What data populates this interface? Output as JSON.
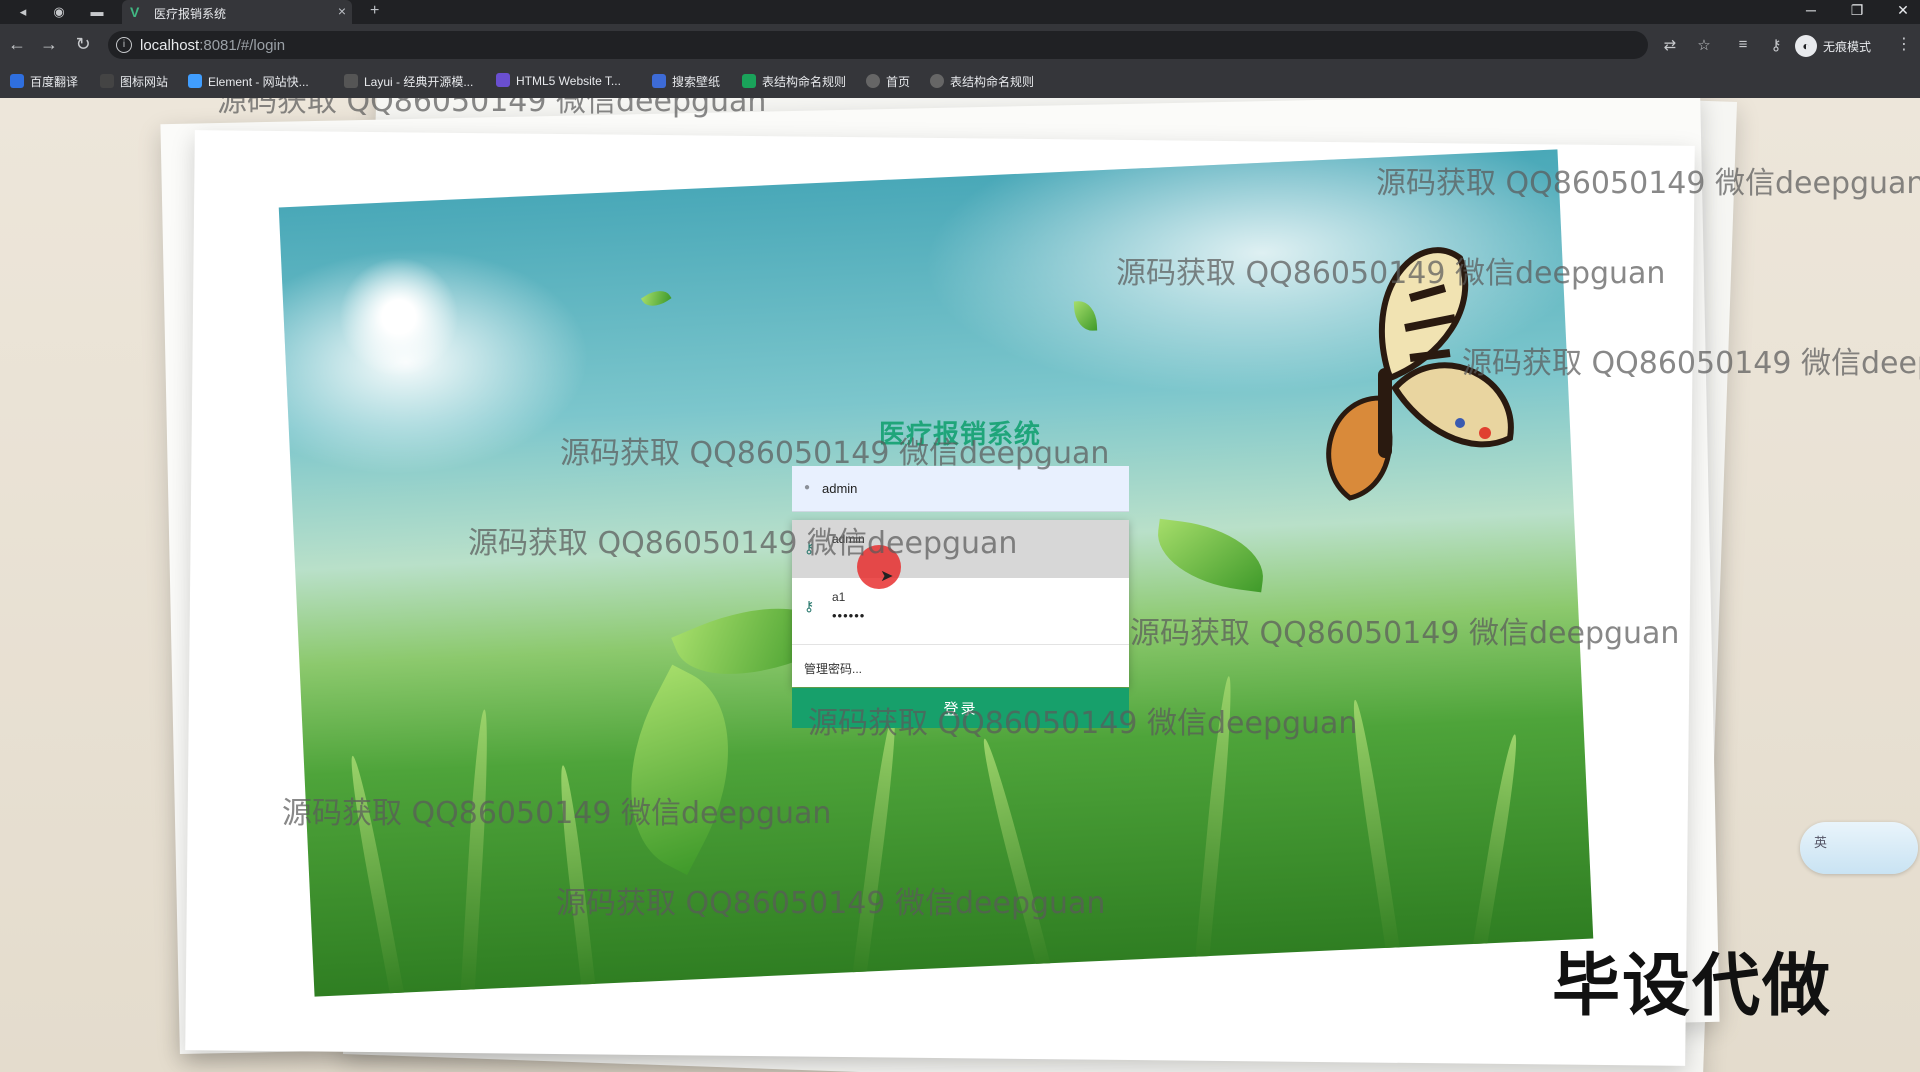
{
  "browser": {
    "tab": {
      "title": "医疗报销系统",
      "close_glyph": "×",
      "new_tab_glyph": "+"
    },
    "url": {
      "host": "localhost",
      "rest": ":8081/#/login"
    },
    "incognito_label": "无痕模式",
    "bookmarks": [
      {
        "label": "百度翻译",
        "color": "#2f6fdf"
      },
      {
        "label": "图标网站",
        "color": "#444444"
      },
      {
        "label": "Element - 网站快...",
        "color": "#409eff"
      },
      {
        "label": "Layui - 经典开源模...",
        "color": "#555555"
      },
      {
        "label": "HTML5 Website T...",
        "color": "#6a4fd0"
      },
      {
        "label": "搜索壁纸",
        "color": "#3d6bd6"
      },
      {
        "label": "表结构命名规则",
        "color": "#1aa35a"
      },
      {
        "label": "首页",
        "color": "#666666"
      },
      {
        "label": "表结构命名规则",
        "color": "#666666"
      }
    ]
  },
  "login": {
    "title": "医疗报销系统",
    "username_value": "admin",
    "autofill": [
      {
        "name": "admin",
        "password_mask": ""
      },
      {
        "name": "a1",
        "password_mask": "••••••"
      }
    ],
    "manage_passwords": "管理密码...",
    "submit_label": "登录"
  },
  "watermark_text": "源码获取 QQ86050149 微信deepguan",
  "watermark_partial": "源码获取 QQ86050149 微信deep",
  "corner_text": "毕设代做",
  "ime_label": "英",
  "colors": {
    "accent": "#17a06b",
    "title_green": "#1fa57a",
    "chrome_dark": "#202124"
  }
}
